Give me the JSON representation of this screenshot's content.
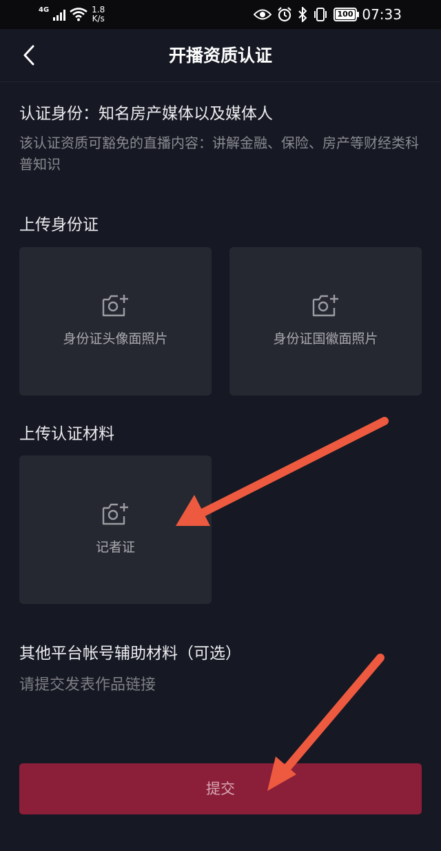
{
  "status_bar": {
    "network": "4G",
    "speed_value": "1.8",
    "speed_unit": "K/s",
    "battery": "100",
    "time": "07:33"
  },
  "header": {
    "title": "开播资质认证"
  },
  "identity": {
    "title": "认证身份：知名房产媒体以及媒体人",
    "description": "该认证资质可豁免的直播内容：讲解金融、保险、房产等财经类科普知识"
  },
  "id_card": {
    "section_title": "上传身份证",
    "front_label": "身份证头像面照片",
    "back_label": "身份证国徽面照片"
  },
  "materials": {
    "section_title": "上传认证材料",
    "press_card_label": "记者证"
  },
  "other_platform": {
    "title": "其他平台帐号辅助材料（可选）",
    "placeholder": "请提交发表作品链接"
  },
  "submit": {
    "label": "提交"
  },
  "colors": {
    "background": "#161823",
    "card": "#262831",
    "submit": "#8b1f39",
    "annotation_arrow": "#ee5a3f"
  }
}
